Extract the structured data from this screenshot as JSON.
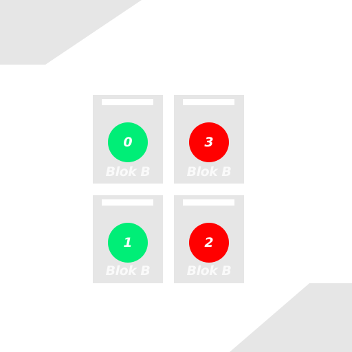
{
  "theme": {
    "background": "#ffffff",
    "panel": "#e6e6e6",
    "corner": "#e6e6e6",
    "on_color": "#00ee77",
    "off_color": "#ff0000",
    "text_color": "#ffffff"
  },
  "slots": [
    {
      "number": "0",
      "label": "Blok B",
      "status": "green"
    },
    {
      "number": "3",
      "label": "Blok B",
      "status": "red"
    },
    {
      "number": "1",
      "label": "Blok B",
      "status": "green"
    },
    {
      "number": "2",
      "label": "Blok B",
      "status": "red"
    }
  ]
}
